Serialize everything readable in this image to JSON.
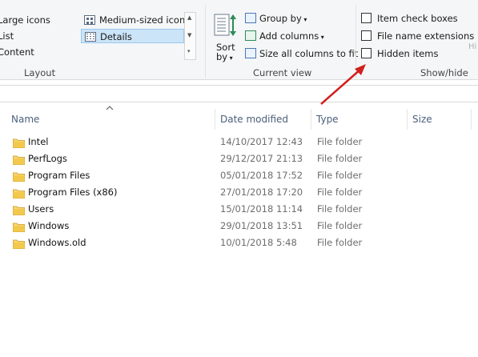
{
  "ribbon": {
    "layout": {
      "items": [
        "Large icons",
        "List",
        "Content",
        "Medium-sized icons",
        "Details"
      ],
      "group_label": "Layout"
    },
    "current_view": {
      "sort_label_1": "Sort",
      "sort_label_2": "by",
      "group_by": "Group by",
      "add_columns": "Add columns",
      "size_all_columns": "Size all columns to fit",
      "group_label": "Current view"
    },
    "show_hide": {
      "item_check_boxes": "Item check boxes",
      "file_name_extensions": "File name extensions",
      "hidden_items": "Hidden items",
      "hide_partial": "Hi",
      "group_label": "Show/hide"
    }
  },
  "columns": [
    "Name",
    "Date modified",
    "Type",
    "Size"
  ],
  "rows": [
    {
      "name": "Intel",
      "date": "14/10/2017 12:43",
      "type": "File folder"
    },
    {
      "name": "PerfLogs",
      "date": "29/12/2017 21:13",
      "type": "File folder"
    },
    {
      "name": "Program Files",
      "date": "05/01/2018 17:52",
      "type": "File folder"
    },
    {
      "name": "Program Files (x86)",
      "date": "27/01/2018 17:20",
      "type": "File folder"
    },
    {
      "name": "Users",
      "date": "15/01/2018 11:14",
      "type": "File folder"
    },
    {
      "name": "Windows",
      "date": "29/01/2018 13:51",
      "type": "File folder"
    },
    {
      "name": "Windows.old",
      "date": "10/01/2018 5:48",
      "type": "File folder"
    }
  ],
  "colors": {
    "selection": "#cce4f7",
    "folder": "#f2c94c",
    "arrow": "#d0201e",
    "header_text": "#4c607a"
  }
}
